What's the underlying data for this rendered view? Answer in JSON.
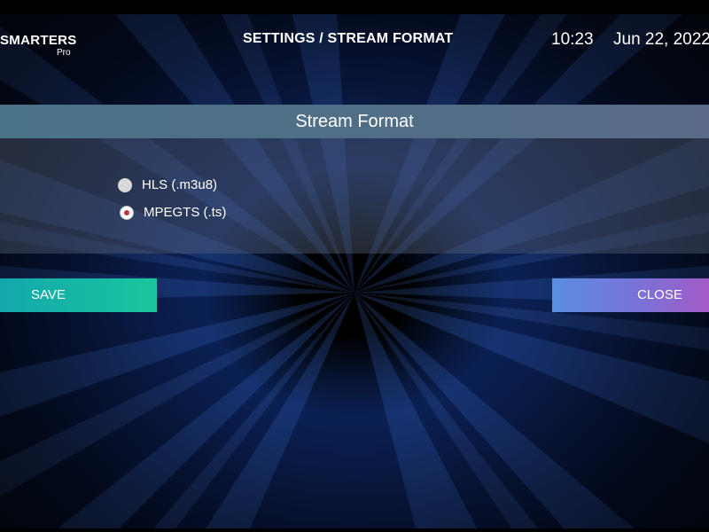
{
  "app": {
    "logo_main": "SMARTERS",
    "logo_sub": "Pro"
  },
  "header": {
    "title": "SETTINGS / STREAM FORMAT",
    "time": "10:23",
    "date": "Jun 22, 2022"
  },
  "panel": {
    "title": "Stream Format",
    "options": [
      {
        "label": "HLS (.m3u8)",
        "selected": false
      },
      {
        "label": "MPEGTS (.ts)",
        "selected": true
      }
    ]
  },
  "buttons": {
    "save_label": "SAVE",
    "close_label": "CLOSE"
  },
  "colors": {
    "save_gradient_start": "#13a8ad",
    "save_gradient_end": "#1bc59d",
    "close_gradient_start": "#5a8ee0",
    "close_gradient_end": "#a35ac8",
    "radio_selected_dot": "#c4334f"
  }
}
